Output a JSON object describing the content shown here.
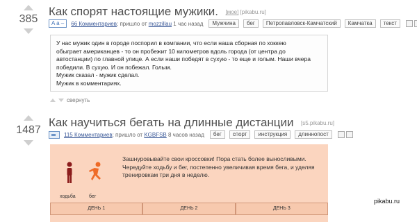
{
  "post1": {
    "score": "385",
    "title": "Как спорят настоящие мужики.",
    "domain_my": "[мое]",
    "domain_site": "[pikabu.ru]",
    "format_button": "A a –",
    "comments": "66 Комментариев",
    "posted_by_text": "; пришло от",
    "author": "mozzillau",
    "time": "1 час назад",
    "tags": [
      "Мужчина",
      "бег",
      "Петропавловск-Камчатский",
      "Камчатка",
      "текст"
    ],
    "story_lines": [
      "У нас мужик один в городе поспорил в компании, что если наша сборная по хоккею",
      "обыграет американцев - то он пробежит 10 километров вдоль города (от центра до",
      "автостанции) по главной улице. А если наши победят в сухую - то еще и голым. Наши вчера",
      "победили. В сухую. И он побежал. Голым.",
      "Мужик сказал - мужик сделал.",
      "Мужик в комментариях."
    ],
    "collapse_label": "свернуть"
  },
  "post2": {
    "score": "1487",
    "title": "Как научиться бегать на длинные дистанции",
    "domain_site": "[s5.pikabu.ru]",
    "comments": "115 Комментариев",
    "posted_by_text": "; пришло от",
    "author": "KGBFSB",
    "time": "8 часов назад",
    "tags": [
      "бег",
      "спорт",
      "инструкция",
      "длиннопост"
    ],
    "info_text": "Зашнуровывайте свои кроссовки! Пора стать более выносливыми. Чередуйте ходьбу и бег, постепенно увеличивая время бега, и уделяя тренировкам три дня в неделю.",
    "figure_labels": [
      "ходьба",
      "бег"
    ],
    "days": [
      "ДЕНЬ 1",
      "ДЕНЬ 2",
      "ДЕНЬ 3"
    ],
    "colors": {
      "walk": "#8b1c1c",
      "run": "#ef6b27",
      "panel": "#fbd5bf"
    }
  },
  "watermark": "pikabu.ru"
}
